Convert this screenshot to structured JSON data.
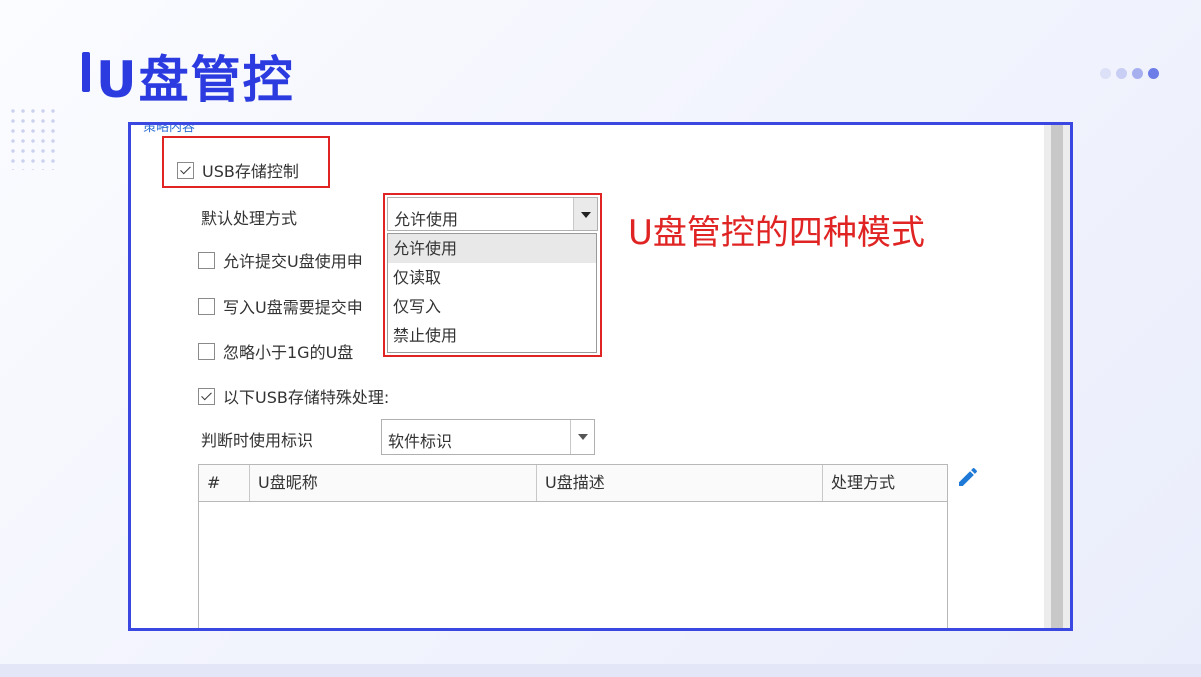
{
  "slide": {
    "title": "U盘管控",
    "annotation": "U盘管控的四种模式"
  },
  "panel": {
    "section_header": "策略内容",
    "usb_storage_control": {
      "label": "USB存储控制",
      "checked": true
    },
    "default_handling": {
      "label": "默认处理方式",
      "selected": "允许使用",
      "options": [
        "允许使用",
        "仅读取",
        "仅写入",
        "禁止使用"
      ],
      "highlighted": "允许使用"
    },
    "options": [
      {
        "label": "允许提交U盘使用申",
        "checked": false
      },
      {
        "label": "写入U盘需要提交申",
        "checked": false
      },
      {
        "label": "忽略小于1G的U盘",
        "checked": false
      },
      {
        "label": "以下USB存储特殊处理:",
        "checked": true
      }
    ],
    "identify": {
      "label": "判断时使用标识",
      "selected": "软件标识"
    },
    "table": {
      "columns": [
        "#",
        "U盘昵称",
        "U盘描述",
        "处理方式"
      ],
      "rows": []
    },
    "edit_icon": "pencil-icon"
  },
  "colors": {
    "accent": "#2c3be0",
    "frame": "#3a47e0",
    "highlight": "#e02424",
    "pencil": "#1e7ad6"
  }
}
